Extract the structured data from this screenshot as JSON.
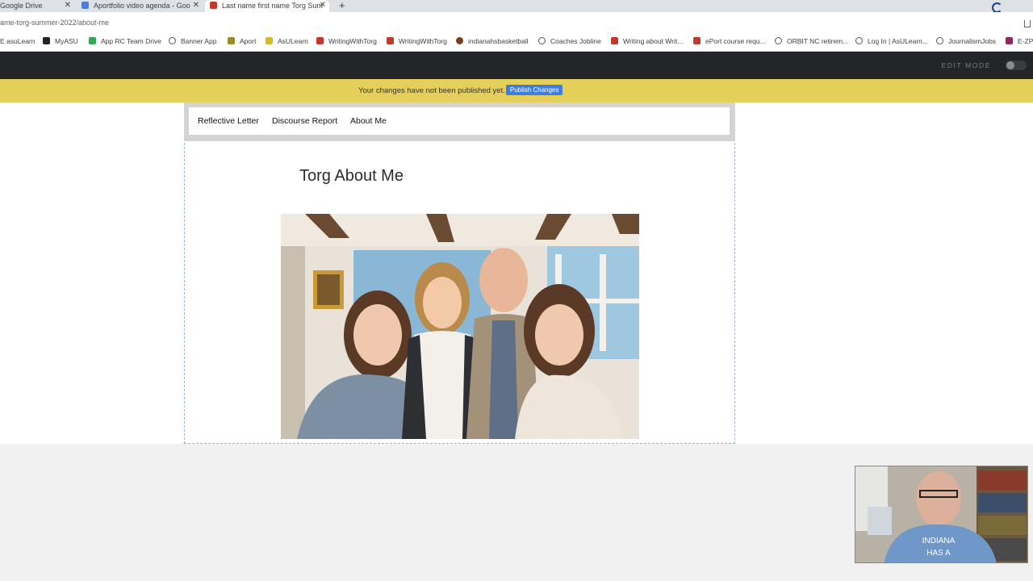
{
  "browser": {
    "tabs": [
      {
        "title": "Google Drive",
        "active": false
      },
      {
        "title": "Aportfolio video agenda - Goo",
        "active": false
      },
      {
        "title": "Last name first name Torg Sum",
        "active": true
      }
    ],
    "url": "ame-torg-summer-2022/about-me",
    "bookmarks": [
      "E asuLearn",
      "MyASU",
      "App RC Team Drive",
      "Banner App",
      "Aport",
      "AsULearn",
      "WritingWithTorg",
      "WritingWithTorg",
      "indianahsbasketball",
      "Coaches Jobline",
      "Writing about Writ...",
      "ePort course requ...",
      "ORBIT NC retirem...",
      "Log In | AsULearn...",
      "JournalismJobs",
      "E-ZP"
    ]
  },
  "editor": {
    "edit_mode_label": "EDIT MODE",
    "banner_text": "Your changes have not been published yet.",
    "publish_label": "Publish Changes"
  },
  "site": {
    "nav": [
      "Reflective Letter",
      "Discourse Report",
      "About Me"
    ],
    "page_title": "Torg About Me"
  },
  "webcam": {
    "shirt_text_line1": "INDIANA",
    "shirt_text_line2": "HAS A"
  },
  "colors": {
    "banner": "#e3cf5a",
    "publish_button": "#3f7ed8",
    "editbar": "#232528"
  }
}
